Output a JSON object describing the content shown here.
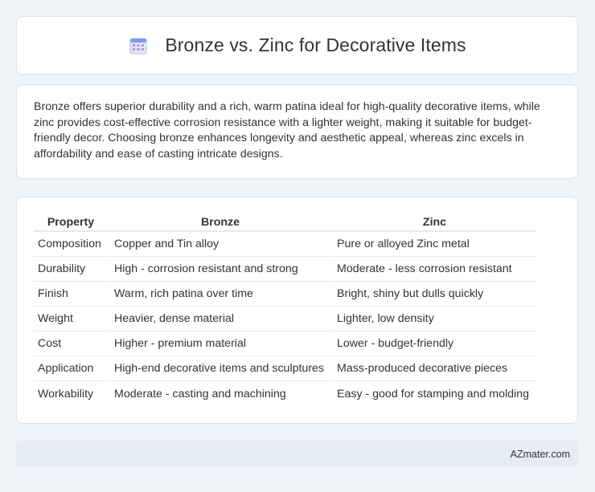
{
  "header": {
    "title": "Bronze vs. Zinc for Decorative Items",
    "icon": "calendar-icon"
  },
  "intro": {
    "text": "Bronze offers superior durability and a rich, warm patina ideal for high-quality decorative items, while zinc provides cost-effective corrosion resistance with a lighter weight, making it suitable for budget-friendly decor. Choosing bronze enhances longevity and aesthetic appeal, whereas zinc excels in affordability and ease of casting intricate designs."
  },
  "table": {
    "headers": [
      "Property",
      "Bronze",
      "Zinc"
    ],
    "rows": [
      [
        "Composition",
        "Copper and Tin alloy",
        "Pure or alloyed Zinc metal"
      ],
      [
        "Durability",
        "High - corrosion resistant and strong",
        "Moderate - less corrosion resistant"
      ],
      [
        "Finish",
        "Warm, rich patina over time",
        "Bright, shiny but dulls quickly"
      ],
      [
        "Weight",
        "Heavier, dense material",
        "Lighter, low density"
      ],
      [
        "Cost",
        "Higher - premium material",
        "Lower - budget-friendly"
      ],
      [
        "Application",
        "High-end decorative items and sculptures",
        "Mass-produced decorative pieces"
      ],
      [
        "Workability",
        "Moderate - casting and machining",
        "Easy - good for stamping and molding"
      ]
    ]
  },
  "footer": {
    "text": "AZmater.com"
  },
  "colors": {
    "background": "#f0f3f8",
    "card": "#ffffff",
    "footer_bg": "#e6ecf6",
    "text": "#333333"
  }
}
